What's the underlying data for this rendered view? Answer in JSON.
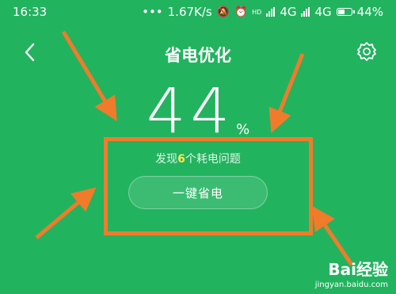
{
  "status_bar": {
    "time": "16:33",
    "dots": "•••",
    "net_speed": "1.67K/s",
    "net1": "4G",
    "net2": "4G",
    "hd_label": "HD",
    "battery_percent": "44%"
  },
  "header": {
    "title": "省电优化"
  },
  "main": {
    "percent_value": "44",
    "percent_unit": "%",
    "issues_prefix": "发现",
    "issues_count": "6",
    "issues_suffix": "个耗电问题",
    "optimize_button_label": "一键省电"
  },
  "watermark": {
    "logo_text": "Bai经验",
    "url": "jingyan.baidu.com"
  },
  "colors": {
    "background": "#22b35f",
    "highlight": "#f07b2b",
    "issue_count": "#ffe94d"
  },
  "icons": [
    "back-icon",
    "settings-icon",
    "signal-icon",
    "battery-icon",
    "alarm-icon",
    "mute-icon"
  ]
}
